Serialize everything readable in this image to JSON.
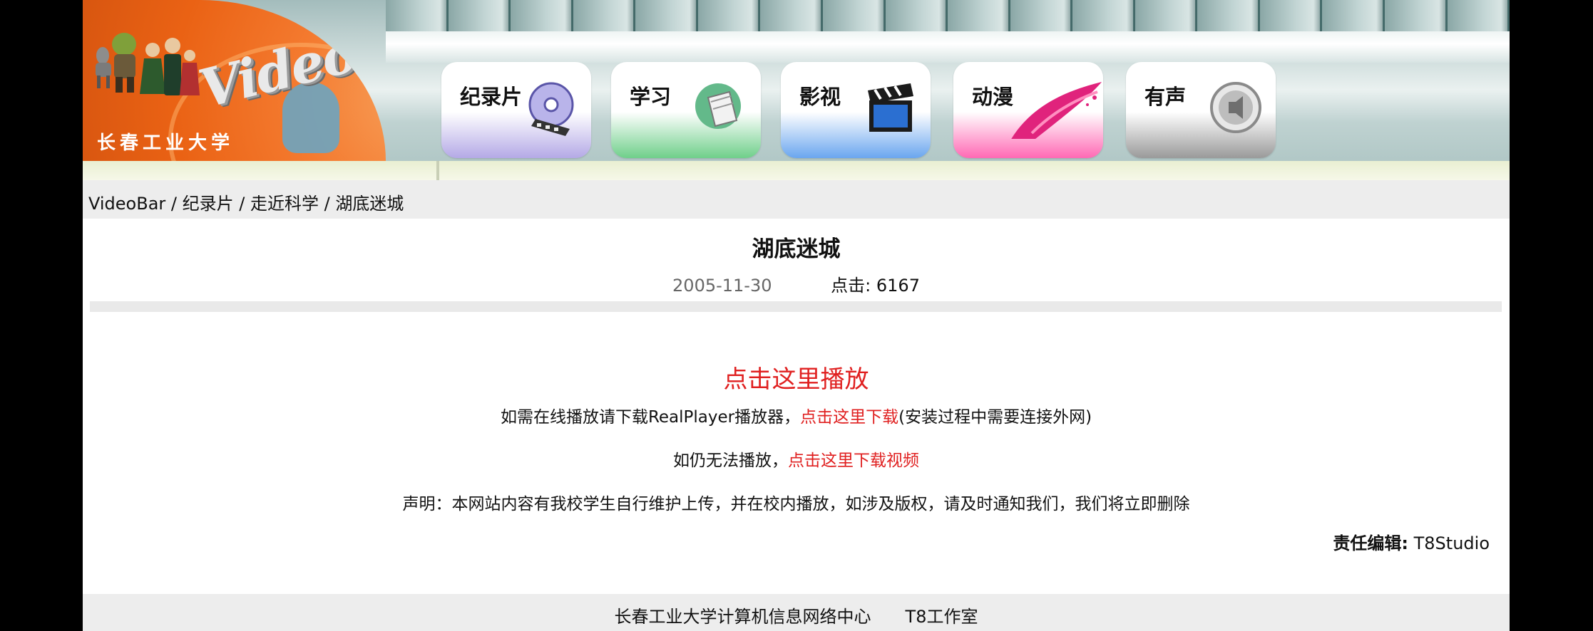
{
  "brand": {
    "logo_text": "VideoBar",
    "school_name": "长春工业大学"
  },
  "nav": {
    "items": [
      {
        "label": "纪录片",
        "icon": "film-disc-icon",
        "bottom_color": "#b4a9e6"
      },
      {
        "label": "学习",
        "icon": "book-icon",
        "bottom_color": "#6fcf8a"
      },
      {
        "label": "影视",
        "icon": "clapperboard-icon",
        "bottom_color": "#6aa6ef"
      },
      {
        "label": "动漫",
        "icon": "brush-stroke-icon",
        "bottom_color": "#ff69b4"
      },
      {
        "label": "有声",
        "icon": "speaker-icon",
        "bottom_color": "#9a9a9a"
      }
    ]
  },
  "breadcrumb": [
    "VideoBar",
    "纪录片",
    "走近科学",
    "湖底迷城"
  ],
  "breadcrumb_sep": " / ",
  "article": {
    "title": "湖底迷城",
    "date": "2005-11-30",
    "hits_label": "点击:",
    "hits": "6167"
  },
  "play": {
    "label": "点击这里播放",
    "player_prefix": "如需在线播放请下载RealPlayer播放器，",
    "player_link": "点击这里下载",
    "player_suffix": "(安装过程中需要连接外网)",
    "fallback_prefix": "如仍无法播放，",
    "fallback_link": "点击这里下载视频",
    "notice": "声明：本网站内容有我校学生自行维护上传，并在校内播放，如涉及版权，请及时通知我们，我们将立即删除"
  },
  "editor": {
    "label": "责任编辑:",
    "name": "T8Studio"
  },
  "footer": {
    "left": "长春工业大学计算机信息网络中心",
    "right": "T8工作室"
  },
  "colors": {
    "link_red": "#e02020",
    "logo_orange": "#f47a2f",
    "panel_gray": "#ededed"
  }
}
